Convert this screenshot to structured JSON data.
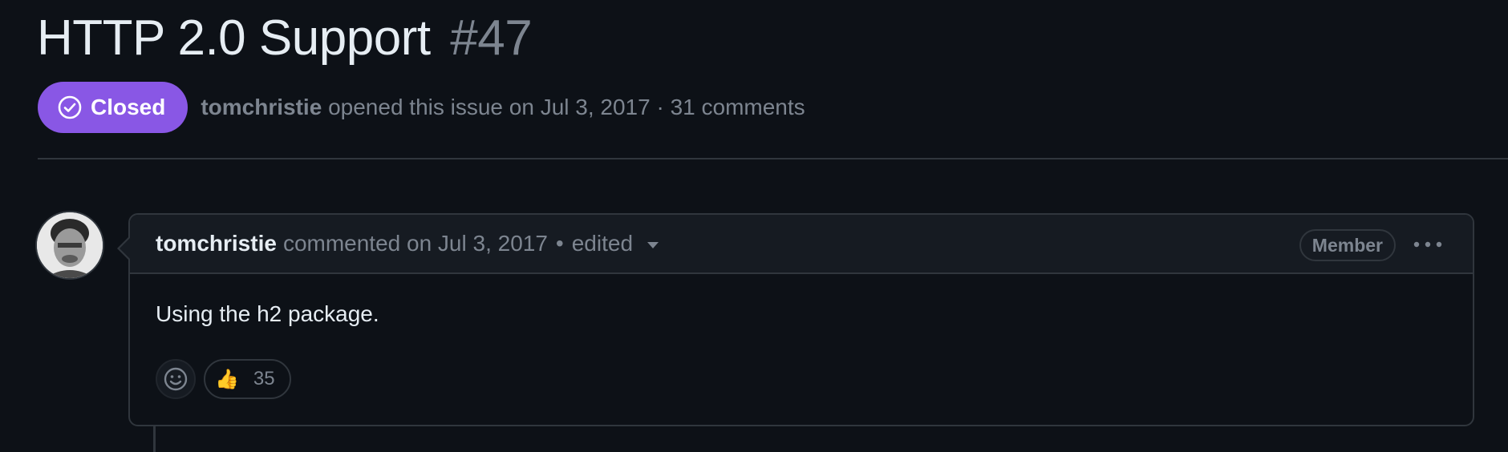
{
  "issue": {
    "title": "HTTP 2.0 Support",
    "number": "#47",
    "state": "Closed",
    "author": "tomchristie",
    "opened_text": "opened this issue on Jul 3, 2017",
    "separator": "·",
    "comments_count": "31 comments"
  },
  "comment": {
    "author": "tomchristie",
    "commented_text": "commented on Jul 3, 2017",
    "separator": "•",
    "edited_label": "edited",
    "role_badge": "Member",
    "body": "Using the h2 package.",
    "reactions": [
      {
        "emoji": "👍",
        "icon": "thumbs-up-icon",
        "count": "35"
      }
    ]
  },
  "colors": {
    "background": "#0d1117",
    "closed_badge": "#8957e5",
    "border": "#30363d",
    "muted_text": "#7d8590",
    "primary_text": "#e6edf3"
  }
}
